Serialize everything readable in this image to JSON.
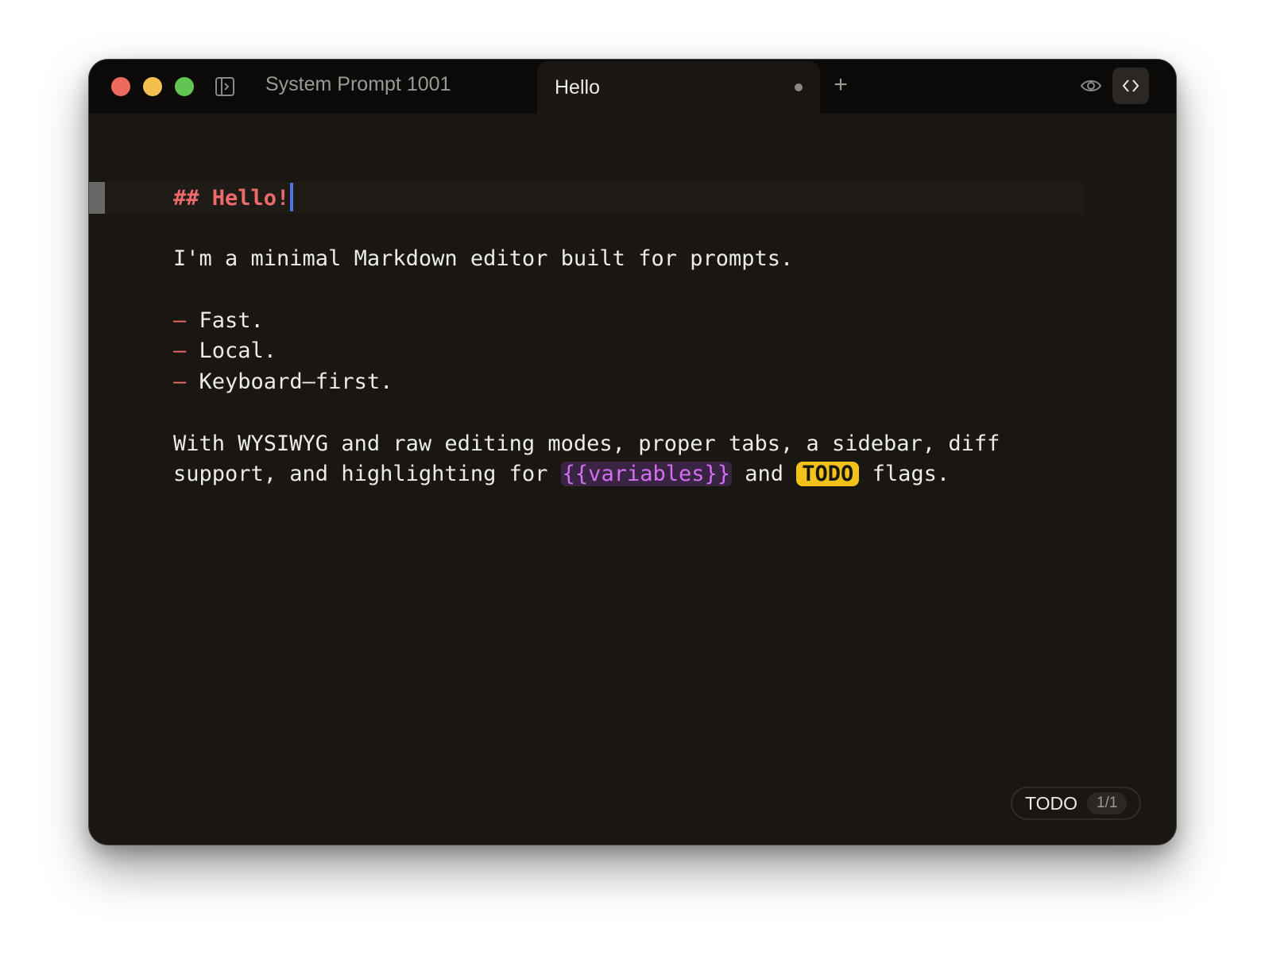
{
  "window": {
    "traffic_lights": {
      "close_color": "#ec6a5e",
      "minimize_color": "#f4bf4f",
      "maximize_color": "#61c554"
    }
  },
  "tabs": [
    {
      "label": "System Prompt 1001",
      "active": false
    },
    {
      "label": "Hello",
      "active": true,
      "unsaved": true
    }
  ],
  "toolbar": {
    "new_tab_label": "+",
    "icons": [
      "sidebar-toggle-icon",
      "eye-icon",
      "code-icon"
    ]
  },
  "editor": {
    "heading": "## Hello!",
    "intro": "I'm a minimal Markdown editor built for prompts.",
    "bullet_marker": "–",
    "bullets": [
      "Fast.",
      "Local.",
      "Keyboard–first."
    ],
    "para_line1": "With WYSIWYG and raw editing modes, proper tabs, a sidebar, diff",
    "para_line2_a": "support, and highlighting for ",
    "variable_token": "{{variables}}",
    "para_line2_b": " and ",
    "todo_token": "TODO",
    "para_line2_c": " flags.",
    "colors": {
      "heading": "#ec6a6a",
      "variable": "#d26ff0",
      "todo_bg": "#f2c21b",
      "cursor": "#4d73e6"
    }
  },
  "todo_indicator": {
    "label": "TODO",
    "count": "1/1"
  }
}
